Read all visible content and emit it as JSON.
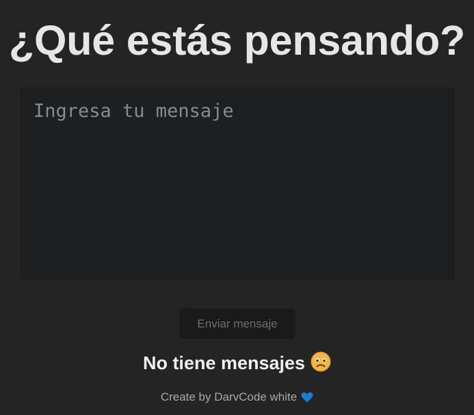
{
  "header": {
    "title": "¿Qué estás pensando?"
  },
  "composer": {
    "placeholder": "Ingresa tu mensaje",
    "value": "",
    "send_label": "Enviar mensaje"
  },
  "messages": {
    "empty_text": "No tiene mensajes",
    "empty_icon": "sad-face-icon"
  },
  "footer": {
    "credit": "Create by DarvCode white",
    "credit_icon": "blue-heart-icon",
    "heart_color": "#1a7fd4"
  },
  "colors": {
    "background": "#242424",
    "textarea_bg": "#1e1f20",
    "button_bg": "#1a1a1a"
  }
}
